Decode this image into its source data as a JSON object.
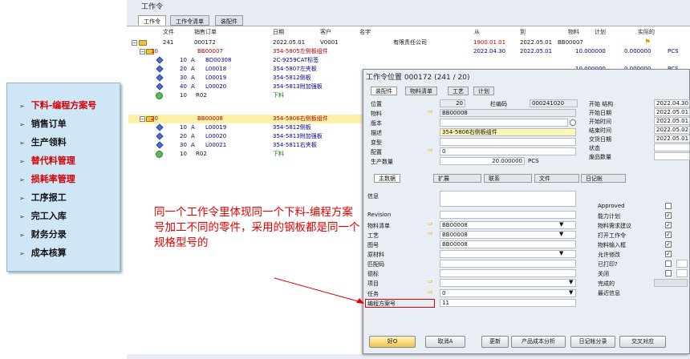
{
  "left_menu": [
    {
      "label": "下料-编程方案号",
      "color": "#d40000"
    },
    {
      "label": "销售订单",
      "color": "#111111"
    },
    {
      "label": "生产领料",
      "color": "#111111"
    },
    {
      "label": "替代料管理",
      "color": "#d40000"
    },
    {
      "label": "损耗率管理",
      "color": "#d40000"
    },
    {
      "label": "工序报工",
      "color": "#111111"
    },
    {
      "label": "完工入库",
      "color": "#111111"
    },
    {
      "label": "财务分录",
      "color": "#111111"
    },
    {
      "label": "成本核算",
      "color": "#111111"
    }
  ],
  "app": {
    "title": "工作令",
    "tabs": [
      "工作令",
      "工作令清单",
      "装配件"
    ]
  },
  "tree": {
    "headers": {
      "file": "文件",
      "sales_order": "销售订单",
      "date": "日期",
      "customer": "客户",
      "name": "名字",
      "from": "从",
      "to": "到",
      "material": "物料",
      "plan": "计划",
      "actual": "实际的"
    },
    "root": {
      "file": "241",
      "sales_order": "000172",
      "date": "2022.05.01",
      "customer": "V0001",
      "name": "有限责任公司",
      "from": "1900.01.01",
      "to": "2022.05.01",
      "material": "BB00007"
    },
    "group1": {
      "num": "10",
      "code": "BB00007",
      "desc": "354-5805左侧板组件",
      "from": "2022.04.30",
      "to": "2022.05.01",
      "qty": "10.000000",
      "actual": "0.000000",
      "unit": "PCS"
    },
    "group1_items": [
      {
        "num": "10",
        "a": "A",
        "code": "BD00308",
        "desc": "2C-9259CAT标签"
      },
      {
        "num": "20",
        "a": "A",
        "code": "L00018",
        "desc": "354-5807左夹板"
      },
      {
        "num": "30",
        "a": "A",
        "code": "L00019",
        "desc": "354-5812侧板"
      },
      {
        "num": "40",
        "a": "A",
        "code": "L00020",
        "desc": "354-5813附加强板"
      },
      {
        "num": "10",
        "a": "",
        "code": "R02",
        "desc": "下料"
      }
    ],
    "group1_extra": {
      "qty": "10.000000",
      "actual": "0.000000",
      "unit": "PCS"
    },
    "group2": {
      "num": "20",
      "code": "BB00008",
      "desc": "354-5806右侧板组件"
    },
    "group2_items": [
      {
        "num": "10",
        "a": "A",
        "code": "L00019",
        "desc": "354-5812侧板"
      },
      {
        "num": "20",
        "a": "A",
        "code": "L00020",
        "desc": "354-5813附加强板"
      },
      {
        "num": "30",
        "a": "A",
        "code": "L00021",
        "desc": "354-5811右夹板"
      },
      {
        "num": "10",
        "a": "",
        "code": "R02",
        "desc": "下料"
      }
    ]
  },
  "dialog": {
    "title": "工作令位置 000172 (241 / 20)",
    "tabs": [
      "装配件",
      "物料清单",
      "工艺",
      "计划"
    ],
    "position_label": "位置",
    "position_value": "20",
    "barcode_label": "栏编码",
    "barcode_value": "000241020",
    "material_label": "物料",
    "material_value": "BB00008",
    "version_label": "版本",
    "desc_label": "描述",
    "desc_value": "354-5806右侧板组件",
    "variant_label": "变型",
    "config_label": "配置",
    "config_value": "0",
    "qty_label": "生产数量",
    "qty_value": "20.000000",
    "qty_unit": "PCS",
    "right_labels": [
      "开始 结构",
      "开始日期",
      "开始时间",
      "结束时间",
      "交货日期",
      "状态",
      "废品数量"
    ],
    "right_values": [
      "2022.04.30",
      "2022.05.01",
      "2022.05.01",
      "2022.05.02",
      "2022.05.01",
      "",
      ""
    ],
    "subtabs": [
      "主数据",
      "扩展",
      "联系",
      "文件",
      "日记帐"
    ],
    "info_label": "信息",
    "revision_label": "Revision",
    "bom_label": "物料清单",
    "bom_value": "BB00008",
    "routing_label": "工艺",
    "routing_value": "BB00008",
    "drawing_label": "图号",
    "drawing_value": "BB00008",
    "raw_label": "原材料",
    "match_label": "匹配码",
    "mark_label": "德标",
    "project_label": "项目",
    "task_label": "任务",
    "task_value": "0",
    "prog_label": "编程方案号",
    "prog_value": "11",
    "flags": [
      {
        "label": "Approved",
        "checked": false
      },
      {
        "label": "能力计划",
        "checked": true
      },
      {
        "label": "物料需求建议",
        "checked": true
      },
      {
        "label": "打开工作令",
        "checked": true
      },
      {
        "label": "物料输入框",
        "checked": true
      },
      {
        "label": "允许修改",
        "checked": true
      },
      {
        "label": "已打印?",
        "checked": false
      },
      {
        "label": "关闭",
        "checked": false
      },
      {
        "label": "完成的",
        "checked": null
      },
      {
        "label": "最近信息",
        "checked": null
      }
    ],
    "buttons": [
      "好O",
      "取消A",
      "更新",
      "产品成本分析",
      "日记帐分录",
      "交叉对应"
    ]
  },
  "annotation": "同一个工作令里体现同一个下料-编程方案号加工不同的零件，采用的钢板都是同一个规格型号的"
}
